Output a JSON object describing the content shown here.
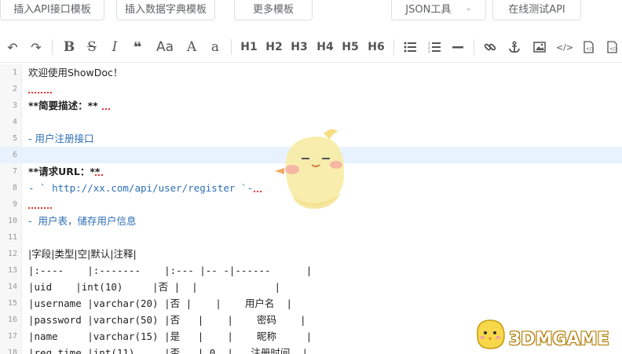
{
  "top_buttons": {
    "insert_api": "插入API接口模板",
    "insert_dict": "插入数据字典模板",
    "more": "更多模板",
    "json_tool": "JSON工具",
    "online_test": "在线测试API"
  },
  "toolbar": {
    "undo": "↶",
    "redo": "↷",
    "bold": "B",
    "strike": "S",
    "italic": "I",
    "quote": "❝",
    "uppercase": "Aa",
    "upper_a": "A",
    "lower_a": "a",
    "h1": "H1",
    "h2": "H2",
    "h3": "H3",
    "h4": "H4",
    "h5": "H5",
    "h6": "H6",
    "ul": "≡",
    "ol": "≡",
    "hr": "—",
    "link": "🔗",
    "anchor": "⚓",
    "image": "▣",
    "code": "</>"
  },
  "editor": {
    "lines": [
      {
        "n": "1",
        "text": "欢迎使用ShowDoc！"
      },
      {
        "n": "2",
        "text": ""
      },
      {
        "n": "3",
        "text": "**简要描述：**"
      },
      {
        "n": "4",
        "text": ""
      },
      {
        "n": "5",
        "text": "- 用户注册接口"
      },
      {
        "n": "6",
        "text": ""
      },
      {
        "n": "7",
        "text": "**请求URL：**"
      },
      {
        "n": "8",
        "text": "- ` http://xx.com/api/user/register `-"
      },
      {
        "n": "9",
        "text": ""
      },
      {
        "n": "10",
        "text": "-  用户表，储存用户信息"
      },
      {
        "n": "11",
        "text": ""
      },
      {
        "n": "12",
        "text": "|字段|类型|空|默认|注释|"
      },
      {
        "n": "13",
        "text": "|:----    |:-------    |:--- |-- -|------      |"
      },
      {
        "n": "14",
        "text": "|uid    |int(10)     |否 |  |             |"
      },
      {
        "n": "15",
        "text": "|username |varchar(20) |否 |    |    用户名  |"
      },
      {
        "n": "16",
        "text": "|password |varchar(50) |否   |    |    密码    |"
      },
      {
        "n": "17",
        "text": "|name     |varchar(15) |是   |    |    昵称     |"
      },
      {
        "n": "18",
        "text": "|reg_time |int(11)     |否   | 0  |   注册时间  |"
      }
    ]
  },
  "watermark": "3DMGAME"
}
